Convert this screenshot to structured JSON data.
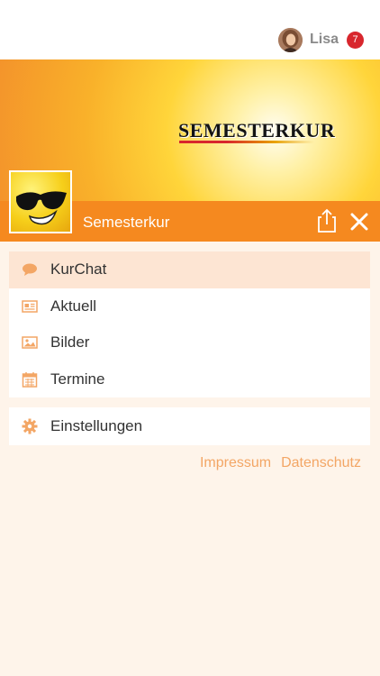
{
  "header": {
    "user": {
      "name": "Lisa",
      "notification_count": "7"
    }
  },
  "banner": {
    "logo_text": "SEMESTERKUR"
  },
  "titlebar": {
    "title": "Semesterkur"
  },
  "menu": {
    "items": [
      {
        "label": "KurChat",
        "icon": "chat-icon",
        "active": true
      },
      {
        "label": "Aktuell",
        "icon": "newspaper-icon",
        "active": false
      },
      {
        "label": "Bilder",
        "icon": "image-icon",
        "active": false
      },
      {
        "label": "Termine",
        "icon": "calendar-icon",
        "active": false
      }
    ],
    "settings": {
      "label": "Einstellungen",
      "icon": "gear-icon"
    }
  },
  "footer": {
    "impressum": "Impressum",
    "datenschutz": "Datenschutz"
  },
  "colors": {
    "accent": "#f5891f",
    "active_row": "#fde5d3",
    "icon": "#f3a665",
    "badge": "#d8262d",
    "background": "#fef4ea"
  }
}
